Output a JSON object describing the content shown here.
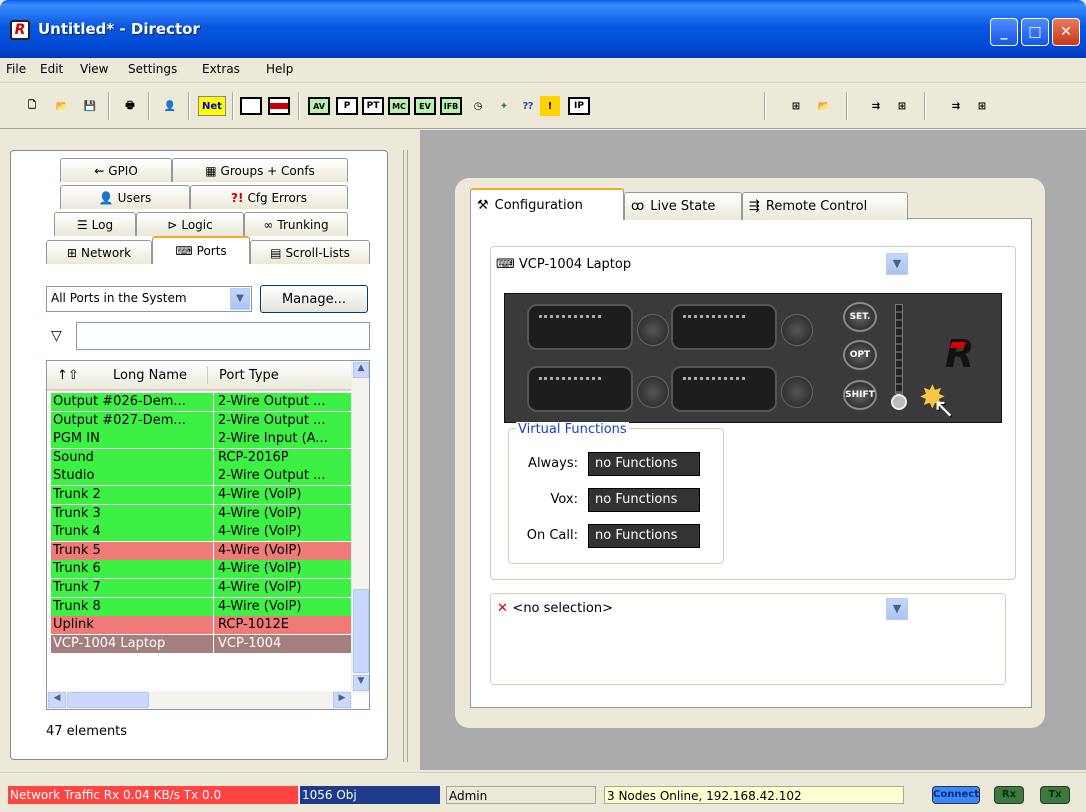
{
  "window": {
    "title": "Untitled* - Director",
    "buttons": [
      "_",
      "□",
      "✕"
    ]
  },
  "menu": [
    "File",
    "Edit",
    "View",
    "Settings",
    "Extras",
    "Help"
  ],
  "toolbar": {
    "net_label": "Net",
    "av": "AV",
    "p": "P",
    "pt": "PT",
    "mc": "MC",
    "ev": "EV",
    "ifb": "IFB",
    "ip": "IP",
    "warn": "!"
  },
  "left_tabs": {
    "gpio": "GPIO",
    "groups": "Groups + Confs",
    "users": "Users",
    "cfg_errors": "Cfg Errors",
    "log": "Log",
    "logic": "Logic",
    "trunking": "Trunking",
    "network": "Network",
    "ports": "Ports",
    "scroll_lists": "Scroll-Lists"
  },
  "ports": {
    "filter_value": "All Ports in the System",
    "manage_label": "Manage...",
    "columns": [
      "Long Name",
      "Port Type"
    ],
    "rows": [
      {
        "name": "Output #026-Dem...",
        "type": "2-Wire Output ...",
        "status": "ok"
      },
      {
        "name": "Output #027-Dem...",
        "type": "2-Wire Output ...",
        "status": "ok"
      },
      {
        "name": "PGM IN",
        "type": "2-Wire Input (A...",
        "status": "ok"
      },
      {
        "name": "Sound",
        "type": "RCP-2016P",
        "status": "ok"
      },
      {
        "name": "Studio",
        "type": "2-Wire Output ...",
        "status": "ok"
      },
      {
        "name": "Trunk 2",
        "type": "4-Wire (VoIP)",
        "status": "ok"
      },
      {
        "name": "Trunk 3",
        "type": "4-Wire (VoIP)",
        "status": "ok"
      },
      {
        "name": "Trunk 4",
        "type": "4-Wire (VoIP)",
        "status": "ok"
      },
      {
        "name": "Trunk 5",
        "type": "4-Wire (VoIP)",
        "status": "error"
      },
      {
        "name": "Trunk 6",
        "type": "4-Wire (VoIP)",
        "status": "ok"
      },
      {
        "name": "Trunk 7",
        "type": "4-Wire (VoIP)",
        "status": "ok"
      },
      {
        "name": "Trunk 8",
        "type": "4-Wire (VoIP)",
        "status": "ok"
      },
      {
        "name": "Uplink",
        "type": "RCP-1012E",
        "status": "error"
      },
      {
        "name": "VCP-1004 Laptop",
        "type": "VCP-1004",
        "status": "selected"
      }
    ],
    "count_label": "47 elements"
  },
  "right_tabs": {
    "configuration": "Configuration",
    "live_state": "Live State",
    "remote_control": "Remote Control"
  },
  "device": {
    "selected": "VCP-1004 Laptop",
    "buttons": {
      "set": "SET.",
      "opt": "OPT",
      "shift": "SHIFT"
    },
    "virtual_functions": {
      "title": "Virtual Functions",
      "always_label": "Always:",
      "always_value": "no Functions",
      "vox_label": "Vox:",
      "vox_value": "no Functions",
      "oncall_label": "On Call:",
      "oncall_value": "no Functions"
    },
    "key_selection": "<no selection>"
  },
  "status": {
    "traffic": "Network Traffic Rx 0.04 KB/s  Tx 0.0",
    "objects": "1056 Obj",
    "user": "Admin",
    "nodes": "3 Nodes Online, 192.168.42.102",
    "connect": "Connect",
    "rx": "Rx",
    "tx": "Tx"
  },
  "colors": {
    "ok": "#3cf044",
    "error": "#f07a78",
    "selected": "#a57e7e",
    "traffic_bg": "#ff4444",
    "objects_bg": "#1e3a8a"
  }
}
